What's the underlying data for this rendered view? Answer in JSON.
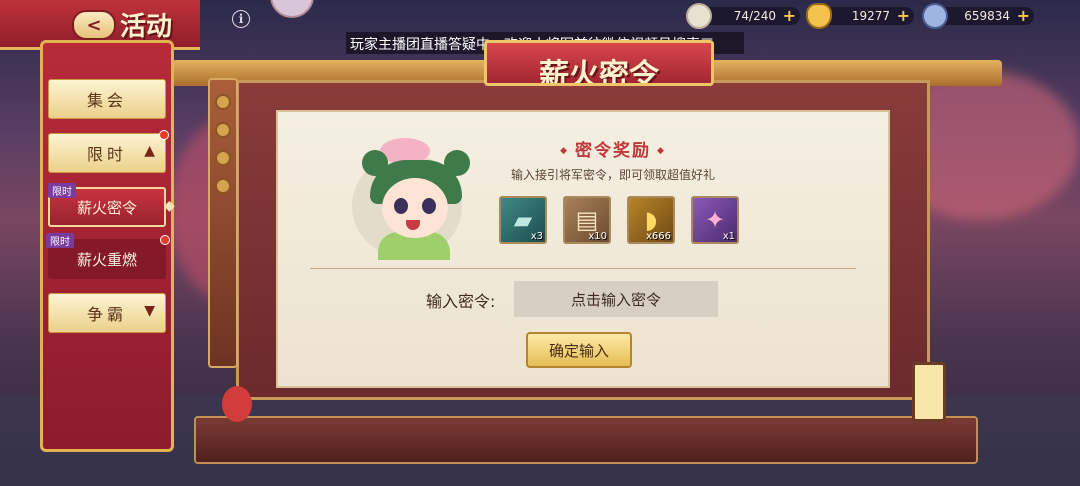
{
  "header": {
    "title": "活动",
    "back_label": "<",
    "info_label": "i",
    "marquee": "玩家主播团直播答疑中，欢迎小将军前往微信视频号搜索三"
  },
  "resources": [
    {
      "name": "stamina",
      "value": "74/240",
      "icon": "bun-icon",
      "color": "#e8e0d0"
    },
    {
      "name": "gold",
      "value": "19277",
      "icon": "gold-ingot-icon",
      "color": "#f2c14e"
    },
    {
      "name": "coin",
      "value": "659834",
      "icon": "coin-icon",
      "color": "#9fb4e0"
    }
  ],
  "sidebar": {
    "items": [
      {
        "label": "集会",
        "type": "category"
      },
      {
        "label": "限时",
        "type": "category",
        "expanded": true,
        "badge": true
      },
      {
        "label": "薪火密令",
        "type": "sub",
        "tag": "限时",
        "active": true
      },
      {
        "label": "薪火重燃",
        "type": "sub",
        "tag": "限时",
        "badge": true
      },
      {
        "label": "争霸",
        "type": "category"
      }
    ]
  },
  "panel": {
    "title": "薪火密令",
    "reward_title": "密令奖励",
    "reward_subtitle": "输入接引将军密令，即可领取超值好礼",
    "rewards": [
      {
        "name": "jade-slip",
        "count": "x3",
        "icon": "jade-token-icon",
        "bg": "#2f6a6a"
      },
      {
        "name": "scroll",
        "count": "x10",
        "icon": "scroll-icon",
        "bg": "#8b6a4a"
      },
      {
        "name": "gold-ingot",
        "count": "x666",
        "icon": "gold-ingot-icon",
        "bg": "#8f6420"
      },
      {
        "name": "purple-card",
        "count": "x1",
        "icon": "ticket-icon",
        "bg": "#6a3c8f"
      }
    ],
    "input_label": "输入密令:",
    "input_placeholder": "点击输入密令",
    "confirm_label": "确定输入"
  }
}
